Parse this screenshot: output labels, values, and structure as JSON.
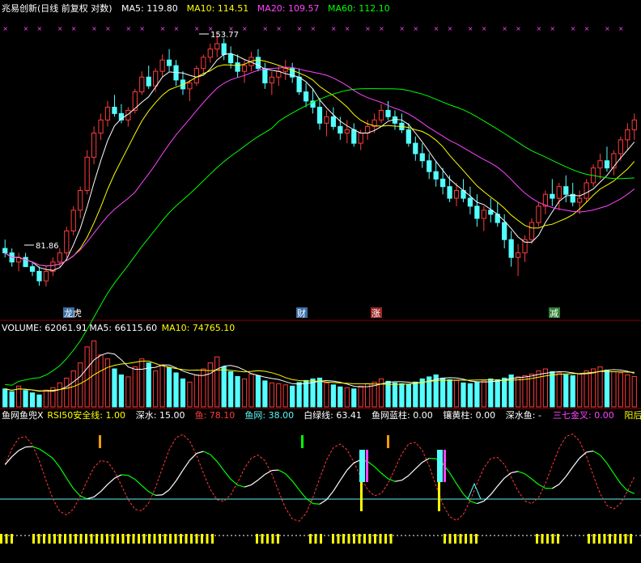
{
  "stock_name": "兆易创新(日线 前复权 对数)",
  "main_legend": [
    {
      "label": "MA5: 119.80",
      "color": "#ffffff"
    },
    {
      "label": "MA10: 114.51",
      "color": "#ffff00"
    },
    {
      "label": "MA20: 109.57",
      "color": "#ff44ff"
    },
    {
      "label": "MA60: 112.10",
      "color": "#00ff00"
    }
  ],
  "price_markers": {
    "high": "153.77",
    "low": "81.86"
  },
  "event_tags": [
    {
      "label": "龙虎",
      "bg": "#3a6ea5",
      "fg": "#ffffff"
    },
    {
      "label": "财",
      "bg": "#3a6ea5",
      "fg": "#ffffff"
    },
    {
      "label": "涨",
      "bg": "#a02828",
      "fg": "#ffffff"
    },
    {
      "label": "减",
      "bg": "#2e7d32",
      "fg": "#ffffff"
    }
  ],
  "volume_legend": [
    {
      "label": "VOLUME: 62061.91",
      "color": "#ffffff"
    },
    {
      "label": "MA5: 66115.60",
      "color": "#ffffff"
    },
    {
      "label": "MA10: 74765.10",
      "color": "#ffff00"
    }
  ],
  "indicator_legend": [
    {
      "label": "鱼网鱼兜X",
      "color": "#ffffff"
    },
    {
      "label": "RSI50安全线: 1.00",
      "color": "#ffff00"
    },
    {
      "label": "深水: 15.00",
      "color": "#ffffff"
    },
    {
      "label": "鱼: 78.10",
      "color": "#ff3b3b"
    },
    {
      "label": "鱼网: 38.00",
      "color": "#5ff5f5"
    },
    {
      "label": "白绿线: 63.41",
      "color": "#ffffff"
    },
    {
      "label": "鱼网蓝柱: 0.00",
      "color": "#ffffff"
    },
    {
      "label": "镶黄柱: 0.00",
      "color": "#ffffff"
    },
    {
      "label": "深水鱼: -",
      "color": "#ffffff"
    },
    {
      "label": "三七金叉: 0.00",
      "color": "#ff44ff"
    },
    {
      "label": "阳后小双",
      "color": "#ffff00"
    }
  ],
  "colors": {
    "up": "#ff3b3b",
    "down": "#54ffff",
    "ma5": "#ffffff",
    "ma10": "#ffff00",
    "ma20": "#ff44ff",
    "ma60": "#00ff00",
    "grid": "#8b0000"
  },
  "chart_data": {
    "type": "candlestick",
    "log_scale": true,
    "price_range": [
      78,
      160
    ],
    "volume_range": [
      0,
      180000
    ],
    "ohlc": [
      [
        90,
        92,
        88,
        89
      ],
      [
        89,
        90,
        86,
        87
      ],
      [
        87,
        89,
        85,
        88
      ],
      [
        88,
        89,
        86,
        86
      ],
      [
        86,
        87,
        84,
        85
      ],
      [
        85,
        86,
        82,
        83
      ],
      [
        83,
        86,
        81.86,
        85
      ],
      [
        85,
        88,
        84,
        87
      ],
      [
        87,
        90,
        86,
        89
      ],
      [
        89,
        95,
        88,
        94
      ],
      [
        94,
        100,
        93,
        99
      ],
      [
        99,
        105,
        97,
        104
      ],
      [
        104,
        115,
        103,
        113
      ],
      [
        113,
        122,
        111,
        120
      ],
      [
        120,
        126,
        118,
        124
      ],
      [
        124,
        130,
        122,
        128
      ],
      [
        128,
        132,
        125,
        126
      ],
      [
        126,
        129,
        123,
        124
      ],
      [
        124,
        128,
        122,
        127
      ],
      [
        127,
        134,
        126,
        133
      ],
      [
        133,
        140,
        132,
        138
      ],
      [
        138,
        142,
        134,
        135
      ],
      [
        135,
        141,
        133,
        140
      ],
      [
        140,
        146,
        138,
        144
      ],
      [
        144,
        148,
        140,
        142
      ],
      [
        142,
        144,
        135,
        137
      ],
      [
        137,
        140,
        132,
        134
      ],
      [
        134,
        137,
        130,
        136
      ],
      [
        136,
        142,
        135,
        141
      ],
      [
        141,
        146,
        139,
        145
      ],
      [
        145,
        150,
        143,
        148
      ],
      [
        148,
        153.77,
        145,
        150
      ],
      [
        150,
        152,
        144,
        146
      ],
      [
        146,
        149,
        141,
        143
      ],
      [
        143,
        146,
        138,
        140
      ],
      [
        140,
        144,
        136,
        142
      ],
      [
        142,
        147,
        140,
        145
      ],
      [
        145,
        148,
        140,
        141
      ],
      [
        141,
        143,
        134,
        136
      ],
      [
        136,
        140,
        132,
        138
      ],
      [
        138,
        142,
        135,
        140
      ],
      [
        140,
        144,
        137,
        141
      ],
      [
        141,
        143,
        136,
        138
      ],
      [
        138,
        141,
        132,
        133
      ],
      [
        133,
        136,
        128,
        130
      ],
      [
        130,
        134,
        126,
        128
      ],
      [
        128,
        131,
        121,
        123
      ],
      [
        123,
        127,
        119,
        125
      ],
      [
        125,
        128,
        121,
        122
      ],
      [
        122,
        125,
        118,
        120
      ],
      [
        120,
        124,
        117,
        121
      ],
      [
        121,
        123,
        116,
        117
      ],
      [
        117,
        121,
        115,
        120
      ],
      [
        120,
        124,
        118,
        122
      ],
      [
        122,
        126,
        120,
        124
      ],
      [
        124,
        129,
        123,
        127
      ],
      [
        127,
        130,
        124,
        125
      ],
      [
        125,
        127,
        121,
        123
      ],
      [
        123,
        126,
        120,
        121
      ],
      [
        121,
        123,
        116,
        117
      ],
      [
        117,
        119,
        112,
        114
      ],
      [
        114,
        117,
        110,
        112
      ],
      [
        112,
        114,
        107,
        109
      ],
      [
        109,
        112,
        105,
        107
      ],
      [
        107,
        110,
        103,
        105
      ],
      [
        105,
        108,
        101,
        102
      ],
      [
        102,
        106,
        100,
        104
      ],
      [
        104,
        107,
        101,
        102
      ],
      [
        102,
        105,
        98,
        100
      ],
      [
        100,
        103,
        95,
        97
      ],
      [
        97,
        100,
        94,
        99
      ],
      [
        99,
        102,
        96,
        98
      ],
      [
        98,
        101,
        95,
        96
      ],
      [
        96,
        98,
        90,
        92
      ],
      [
        92,
        94,
        86,
        88
      ],
      [
        88,
        91,
        84,
        89
      ],
      [
        89,
        93,
        87,
        92
      ],
      [
        92,
        97,
        91,
        96
      ],
      [
        96,
        101,
        95,
        100
      ],
      [
        100,
        104,
        98,
        103
      ],
      [
        103,
        107,
        100,
        102
      ],
      [
        102,
        106,
        99,
        105
      ],
      [
        105,
        108,
        101,
        103
      ],
      [
        103,
        106,
        100,
        101
      ],
      [
        101,
        104,
        98,
        102
      ],
      [
        102,
        107,
        101,
        106
      ],
      [
        106,
        111,
        105,
        110
      ],
      [
        110,
        114,
        107,
        112
      ],
      [
        112,
        116,
        109,
        110
      ],
      [
        110,
        115,
        108,
        114
      ],
      [
        114,
        119,
        112,
        118
      ],
      [
        118,
        123,
        115,
        121
      ],
      [
        121,
        126,
        118,
        124
      ]
    ],
    "volume": [
      45000,
      38000,
      52000,
      41000,
      35000,
      30000,
      42000,
      48000,
      60000,
      72000,
      90000,
      110000,
      150000,
      165000,
      130000,
      120000,
      95000,
      80000,
      75000,
      100000,
      120000,
      110000,
      90000,
      105000,
      98000,
      85000,
      70000,
      62000,
      80000,
      95000,
      110000,
      125000,
      100000,
      88000,
      76000,
      70000,
      82000,
      78000,
      65000,
      60000,
      58000,
      55000,
      52000,
      61000,
      66000,
      70000,
      72000,
      60000,
      55000,
      50000,
      48000,
      45000,
      52000,
      58000,
      62000,
      70000,
      64000,
      60000,
      58000,
      56000,
      62000,
      70000,
      75000,
      80000,
      72000,
      68000,
      66000,
      60000,
      58000,
      62000,
      65000,
      70000,
      68000,
      72000,
      80000,
      75000,
      78000,
      82000,
      90000,
      95000,
      88000,
      85000,
      80000,
      78000,
      82000,
      90000,
      95000,
      100000,
      92000,
      88000,
      85000,
      80000,
      76000
    ],
    "series": [
      {
        "name": "MA5",
        "values": []
      },
      {
        "name": "MA10",
        "values": []
      },
      {
        "name": "MA20",
        "values": []
      },
      {
        "name": "MA60",
        "values": []
      }
    ]
  }
}
